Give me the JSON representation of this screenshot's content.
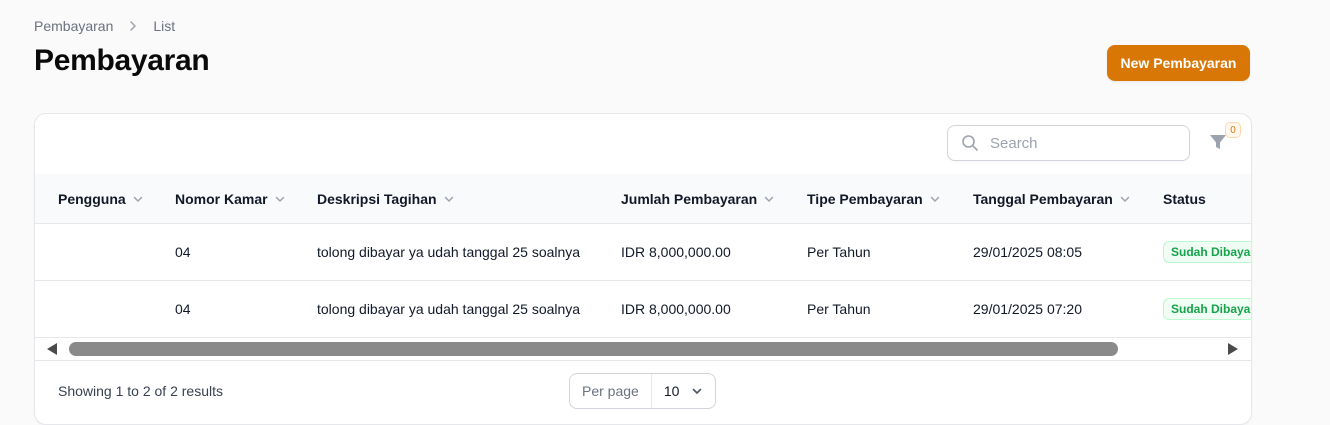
{
  "breadcrumb": {
    "items": [
      "Pembayaran",
      "List"
    ]
  },
  "page": {
    "title": "Pembayaran",
    "new_button": "New Pembayaran"
  },
  "toolbar": {
    "search_placeholder": "Search",
    "filter_count": "0"
  },
  "table": {
    "columns": [
      "Pengguna",
      "Nomor Kamar",
      "Deskripsi Tagihan",
      "Jumlah Pembayaran",
      "Tipe Pembayaran",
      "Tanggal Pembayaran",
      "Status"
    ],
    "rows": [
      {
        "pengguna": "",
        "nomor_kamar": "04",
        "deskripsi": "tolong dibayar ya udah tanggal 25 soalnya",
        "jumlah": "IDR 8,000,000.00",
        "tipe": "Per Tahun",
        "tanggal": "29/01/2025 08:05",
        "status": "Sudah Dibayar"
      },
      {
        "pengguna": "",
        "nomor_kamar": "04",
        "deskripsi": "tolong dibayar ya udah tanggal 25 soalnya",
        "jumlah": "IDR 8,000,000.00",
        "tipe": "Per Tahun",
        "tanggal": "29/01/2025 07:20",
        "status": "Sudah Dibayar"
      }
    ]
  },
  "footer": {
    "results": "Showing 1 to 2 of 2 results",
    "per_page_label": "Per page",
    "per_page_value": "10"
  },
  "colors": {
    "accent": "#d97706",
    "success": "#16a34a",
    "success_bg": "#f0fdf4"
  },
  "icons": {
    "search": "search-icon",
    "filter": "filter-icon",
    "sort": "chevron-down-icon",
    "breadcrumb_sep": "chevron-right-icon"
  }
}
